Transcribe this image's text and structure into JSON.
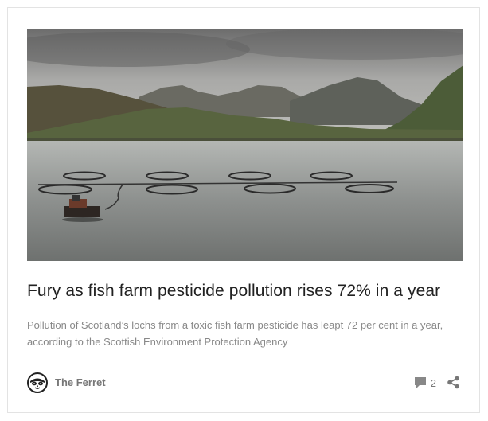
{
  "article": {
    "image_alt": "Salmon fish farm pens on a Scottish loch with mountains in the background",
    "title": "Fury as fish farm pesticide pollution rises 72% in a year",
    "excerpt": "Pollution of Scotland’s lochs from a toxic fish farm pesticide has leapt 72 per cent in a year, according to the Scottish Environment Protection Agency"
  },
  "footer": {
    "author_name": "The Ferret",
    "author_icon": "ferret-logo-icon",
    "comment_icon": "comment-icon",
    "comment_count": "2",
    "share_icon": "share-icon"
  }
}
